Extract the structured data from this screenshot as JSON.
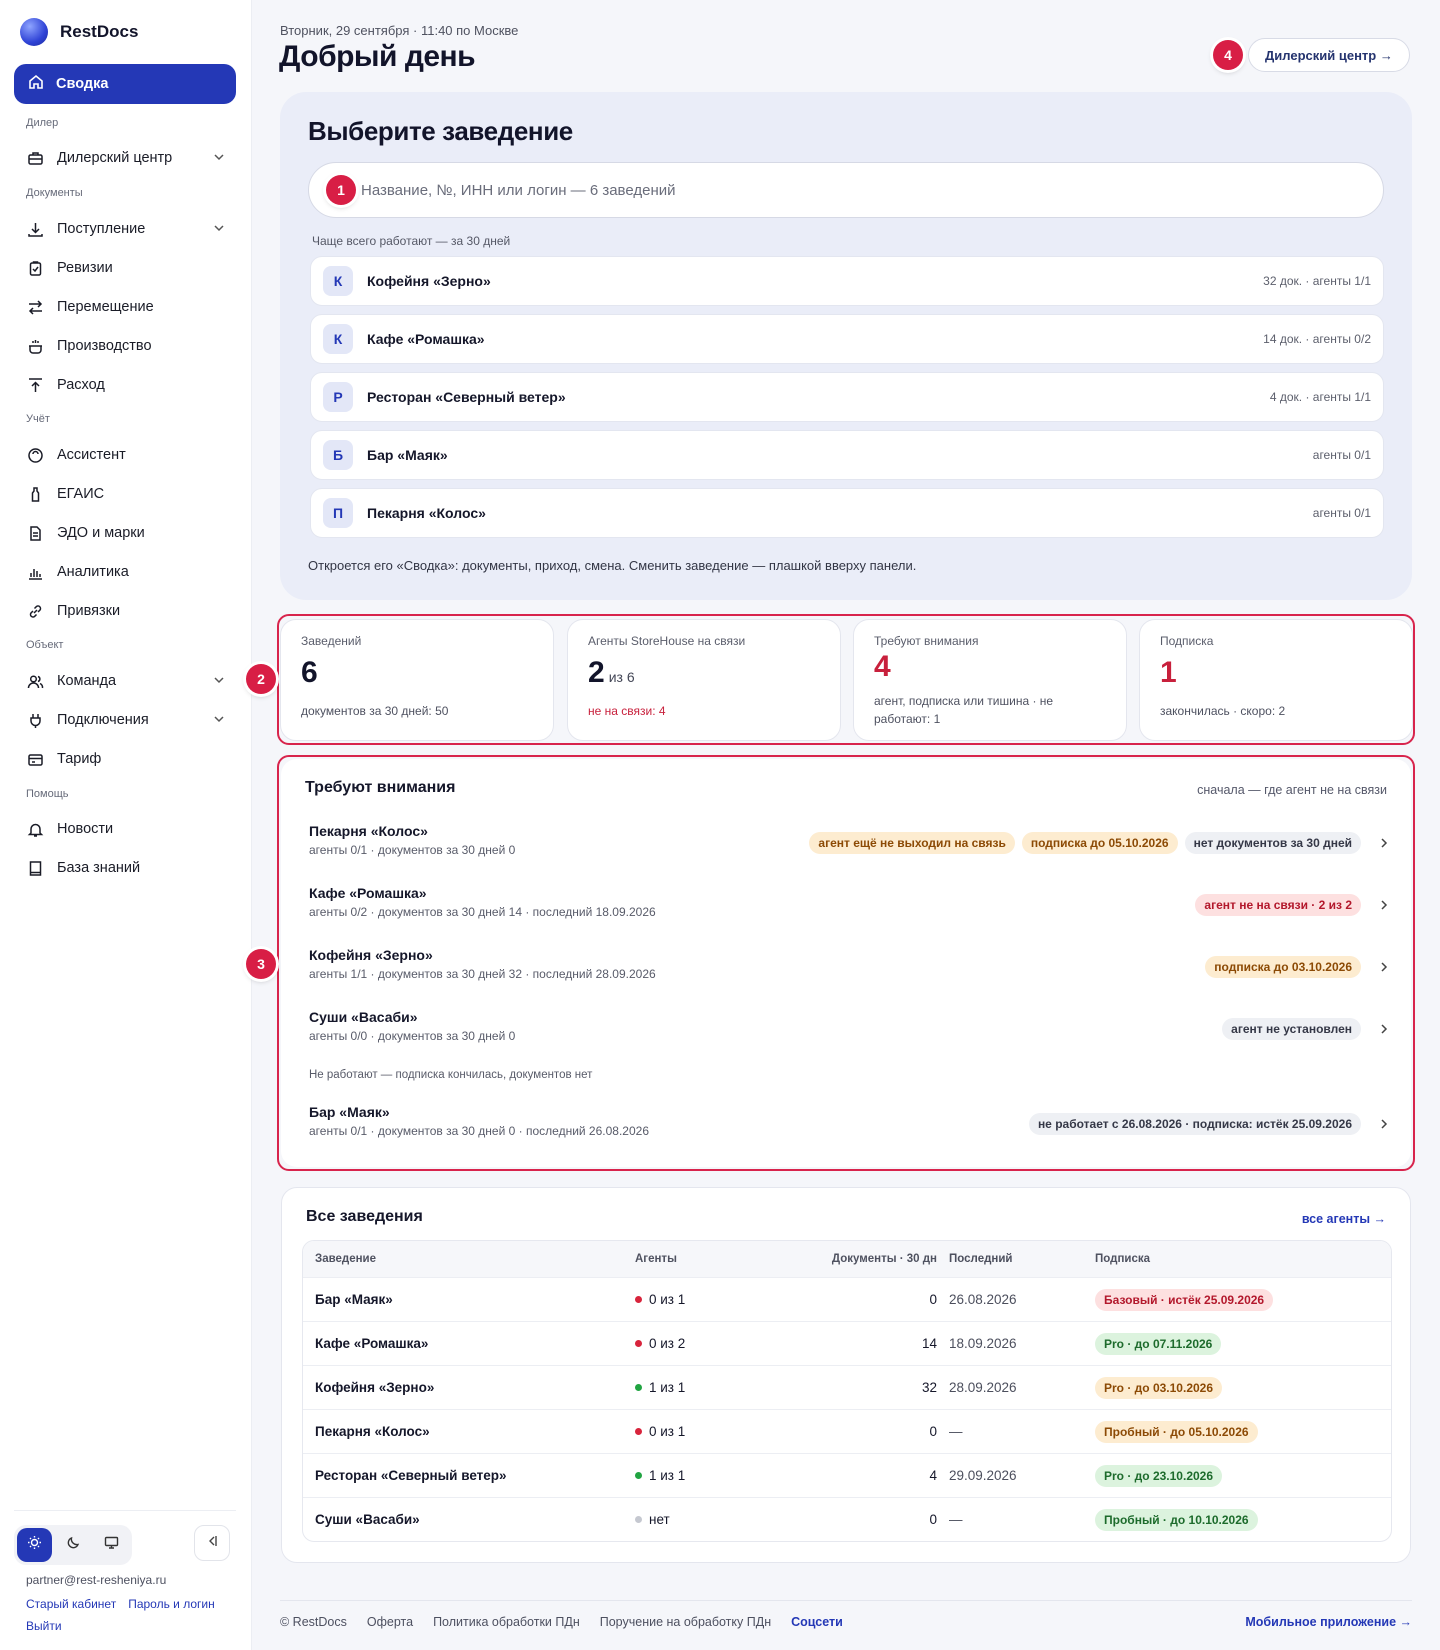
{
  "sidebar": {
    "brand": "RestDocs",
    "active": "Сводка",
    "sections": {
      "dealer": "Дилер",
      "docs": "Документы",
      "accounting": "Учёт",
      "object": "Объект",
      "help": "Помощь"
    },
    "items": {
      "dealer_center": "Дилерский центр",
      "receipt": "Поступление",
      "revisions": "Ревизии",
      "transfer": "Перемещение",
      "production": "Производство",
      "expense": "Расход",
      "assistant": "Ассистент",
      "egais": "ЕГАИС",
      "edo": "ЭДО и марки",
      "analytics": "Аналитика",
      "bindings": "Привязки",
      "team": "Команда",
      "connections": "Подключения",
      "tariff": "Тариф",
      "news": "Новости",
      "knowledge": "База знаний"
    },
    "email": "partner@rest-resheniya.ru",
    "old_cabinet": "Старый кабинет",
    "password_login": "Пароль и логин",
    "logout": "Выйти"
  },
  "header": {
    "date": "Вторник, 29 сентября · 11:40 по Москве",
    "greeting": "Добрый день",
    "dealer_button": "Дилерский центр →"
  },
  "badges": {
    "b1": "1",
    "b2": "2",
    "b3": "3",
    "b4": "4"
  },
  "pick": {
    "title": "Выберите заведение",
    "search_placeholder": "Название, №, ИНН или логин — 6 заведений",
    "frequent_label": "Чаще всего работают — за 30 дней",
    "venues": [
      {
        "letter": "К",
        "name": "Кофейня «Зерно»",
        "meta": "32 док. · агенты 1/1"
      },
      {
        "letter": "К",
        "name": "Кафе «Ромашка»",
        "meta": "14 док. · агенты 0/2"
      },
      {
        "letter": "Р",
        "name": "Ресторан «Северный ветер»",
        "meta": "4 док. · агенты 1/1"
      },
      {
        "letter": "Б",
        "name": "Бар «Маяк»",
        "meta": "агенты 0/1"
      },
      {
        "letter": "П",
        "name": "Пекарня «Колос»",
        "meta": "агенты 0/1"
      }
    ],
    "note": "Откроется его «Сводка»: документы, приход, смена. Сменить заведение — плашкой вверху панели."
  },
  "stats": [
    {
      "label": "Заведений",
      "value": "6",
      "of": "",
      "sub": "документов за 30 дней: 50"
    },
    {
      "label": "Агенты StoreHouse на связи",
      "value": "2",
      "of": "из 6",
      "sub": "не на связи: 4"
    },
    {
      "label": "Требуют внимания",
      "value": "4",
      "of": "",
      "sub": "агент, подписка или тишина · не работают: 1"
    },
    {
      "label": "Подписка",
      "value": "1",
      "of": "",
      "sub": "закончилась · скоро: 2"
    }
  ],
  "attention": {
    "title": "Требуют внимания",
    "sort": "сначала — где агент не на связи",
    "separator": "Не работают — подписка кончилась, документов нет",
    "rows": [
      {
        "name": "Пекарня «Колос»",
        "meta": "агенты 0/1 · документов за 30 дней 0",
        "tags": [
          "агент ещё не выходил на связь",
          "подписка до 05.10.2026",
          "нет документов за 30 дней"
        ]
      },
      {
        "name": "Кафе «Ромашка»",
        "meta": "агенты 0/2 · документов за 30 дней 14 · последний 18.09.2026",
        "tags": [
          "агент не на связи · 2 из 2"
        ]
      },
      {
        "name": "Кофейня «Зерно»",
        "meta": "агенты 1/1 · документов за 30 дней 32 · последний 28.09.2026",
        "tags": [
          "подписка до 03.10.2026"
        ]
      },
      {
        "name": "Суши «Васаби»",
        "meta": "агенты 0/0 · документов за 30 дней 0",
        "tags": [
          "агент не установлен"
        ]
      },
      {
        "name": "Бар «Маяк»",
        "meta": "агенты 0/1 · документов за 30 дней 0 · последний 26.08.2026",
        "tags": [
          "не работает с 26.08.2026 · подписка: истёк 25.09.2026"
        ]
      }
    ]
  },
  "all": {
    "title": "Все заведения",
    "link": "все агенты →",
    "columns": [
      "Заведение",
      "Агенты",
      "Документы · 30 дн",
      "Последний",
      "Подписка"
    ],
    "rows": [
      {
        "name": "Бар «Маяк»",
        "agents": "0 из 1",
        "agent_status": "red",
        "docs": "0",
        "last": "26.08.2026",
        "sub": "Базовый · истёк 25.09.2026",
        "sub_color": "red"
      },
      {
        "name": "Кафе «Ромашка»",
        "agents": "0 из 2",
        "agent_status": "red",
        "docs": "14",
        "last": "18.09.2026",
        "sub": "Pro · до 07.11.2026",
        "sub_color": "green"
      },
      {
        "name": "Кофейня «Зерно»",
        "agents": "1 из 1",
        "agent_status": "green",
        "docs": "32",
        "last": "28.09.2026",
        "sub": "Pro · до 03.10.2026",
        "sub_color": "orange"
      },
      {
        "name": "Пекарня «Колос»",
        "agents": "0 из 1",
        "agent_status": "red",
        "docs": "0",
        "last": "—",
        "sub": "Пробный · до 05.10.2026",
        "sub_color": "orange"
      },
      {
        "name": "Ресторан «Северный ветер»",
        "agents": "1 из 1",
        "agent_status": "green",
        "docs": "4",
        "last": "29.09.2026",
        "sub": "Pro · до 23.10.2026",
        "sub_color": "green"
      },
      {
        "name": "Суши «Васаби»",
        "agents": "нет",
        "agent_status": "grey",
        "docs": "0",
        "last": "—",
        "sub": "Пробный · до 10.10.2026",
        "sub_color": "green"
      }
    ]
  },
  "footer": {
    "copyright": "© RestDocs",
    "offer": "Оферта",
    "policy": "Политика обработки ПДн",
    "order": "Поручение на обработку ПДн",
    "social": "Соцсети",
    "mobile": "Мобильное приложение →"
  },
  "colors": {
    "accent": "#2438b6",
    "danger": "#d8244c",
    "dot_red": "#d8243c",
    "dot_green": "#21a442",
    "dot_grey": "#c5c8d0"
  }
}
